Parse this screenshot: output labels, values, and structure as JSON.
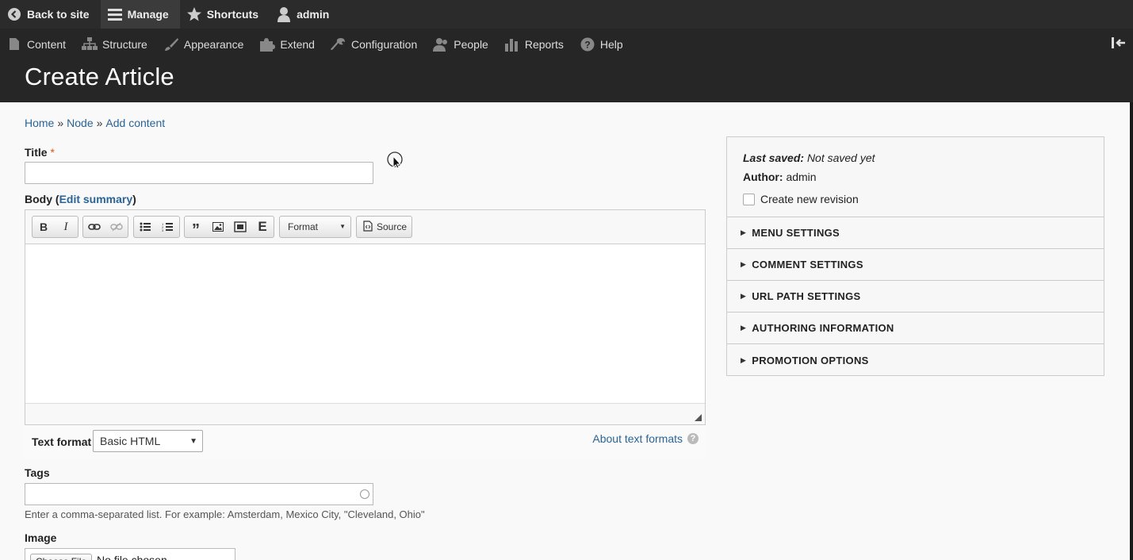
{
  "toolbar": {
    "back": "Back to site",
    "manage": "Manage",
    "shortcuts": "Shortcuts",
    "user": "admin"
  },
  "tray": {
    "items": [
      "Content",
      "Structure",
      "Appearance",
      "Extend",
      "Configuration",
      "People",
      "Reports",
      "Help"
    ]
  },
  "page": {
    "title": "Create Article"
  },
  "breadcrumb": {
    "home": "Home",
    "sep": "»",
    "node": "Node",
    "add": "Add content"
  },
  "form": {
    "title_label": "Title",
    "required_mark": "*",
    "body_label": "Body",
    "edit_summary": "Edit summary",
    "format_label": "Format",
    "source_label": "Source",
    "text_format_label": "Text format",
    "text_format_value": "Basic HTML",
    "about_text_formats": "About text formats",
    "help_mark": "?",
    "tags_label": "Tags",
    "tags_description": "Enter a comma-separated list. For example: Amsterdam, Mexico City, \"Cleveland, Ohio\"",
    "image_label": "Image",
    "choose_file": "Choose File",
    "no_file": "No file chosen"
  },
  "sidebar": {
    "last_saved_label": "Last saved:",
    "last_saved_value": "Not saved yet",
    "author_label": "Author:",
    "author_value": "admin",
    "revision_label": "Create new revision",
    "sections": [
      "MENU SETTINGS",
      "COMMENT SETTINGS",
      "URL PATH SETTINGS",
      "AUTHORING INFORMATION",
      "PROMOTION OPTIONS"
    ]
  },
  "icons": {
    "back": "chevron-left-circle-icon",
    "manage": "hamburger-icon",
    "shortcuts": "star-icon",
    "user": "user-icon"
  }
}
